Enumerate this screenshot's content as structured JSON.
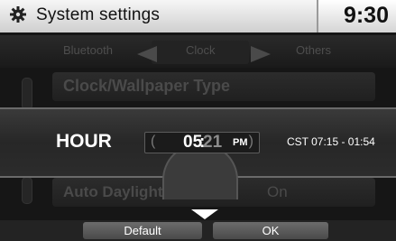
{
  "header": {
    "title": "System settings",
    "time": "9:30",
    "icon": "gear-icon"
  },
  "tabs": {
    "items": [
      {
        "label": "Bluetooth"
      },
      {
        "label": "Clock"
      },
      {
        "label": "Others"
      }
    ],
    "active": "Clock"
  },
  "list": {
    "wallpaper_label": "Clock/Wallpaper Type",
    "daylight_label": "Auto Daylight",
    "daylight_value": "On"
  },
  "hour_setting": {
    "label": "HOUR",
    "hour": "05",
    "colon": ":",
    "minute": "21",
    "ampm": "PM",
    "bracket_left": "(",
    "bracket_right": ")",
    "timezone": "CST 07:15 - 01:54"
  },
  "footer": {
    "default_label": "Default",
    "ok_label": "OK"
  },
  "colors": {
    "header_bg": "#e6e6e6",
    "screen_bg": "#161616",
    "highlight_bar": "#2c2c2c",
    "text_white": "#ffffff",
    "text_dim": "#4a4a4a"
  }
}
